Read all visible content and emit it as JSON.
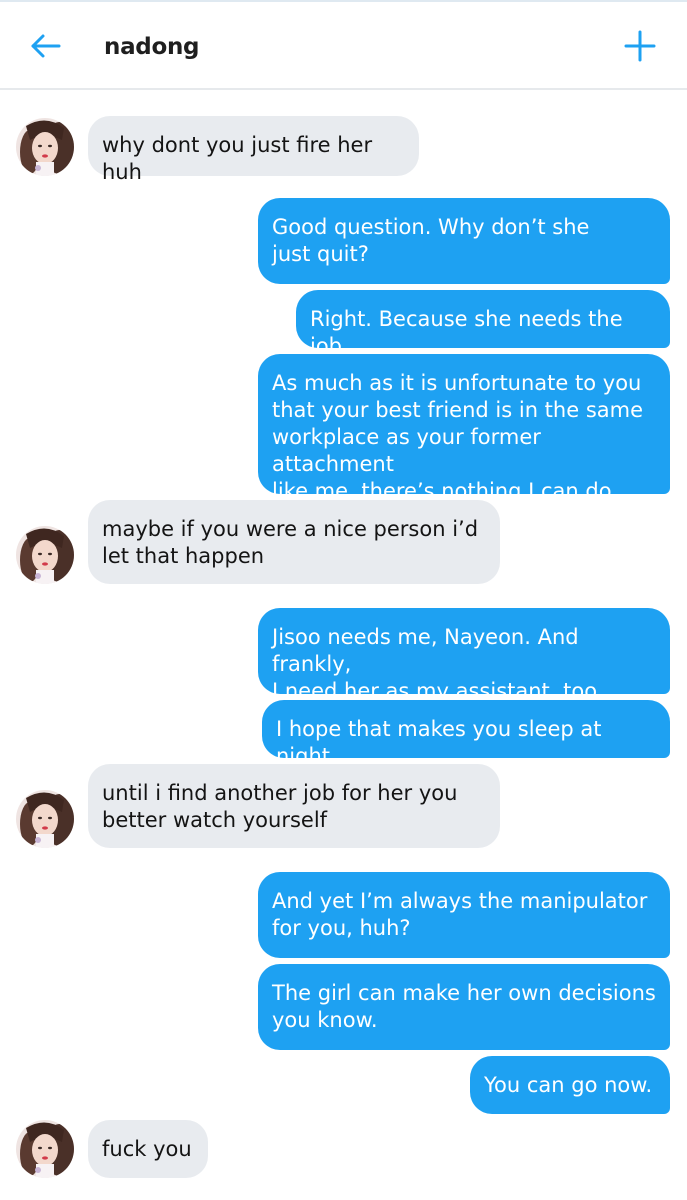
{
  "header": {
    "title": "nadong",
    "back_icon": "arrow-left-icon",
    "add_icon": "plus-icon",
    "accent_color": "#1ea1f2"
  },
  "messages": [
    {
      "side": "in",
      "text": "why dont you just fire her huh"
    },
    {
      "side": "out",
      "text": "Good question. Why don’t she\njust quit?"
    },
    {
      "side": "out",
      "text": "Right. Because she needs the job."
    },
    {
      "side": "out",
      "text": " As much as it is unfortunate to you\nthat your best friend is in the same\nworkplace as your former attachment\nlike me, there’s nothing I can do."
    },
    {
      "side": "in",
      "text": "maybe if you were a nice person i’d\nlet that happen"
    },
    {
      "side": "out",
      "text": "Jisoo needs me, Nayeon. And frankly,\nI need her as my assistant, too."
    },
    {
      "side": "out",
      "text": "I hope that makes you sleep at night."
    },
    {
      "side": "in",
      "text": "until i find another job for her you\nbetter watch yourself"
    },
    {
      "side": "out",
      "text": "And yet I’m always the manipulator\nfor you, huh?"
    },
    {
      "side": "out",
      "text": "The girl can make her own decisions\nyou know."
    },
    {
      "side": "out",
      "text": "You can go now."
    },
    {
      "side": "in",
      "text": "fuck you"
    }
  ],
  "colors": {
    "incoming_bubble": "#e8ebef",
    "outgoing_bubble": "#1ea1f2"
  }
}
